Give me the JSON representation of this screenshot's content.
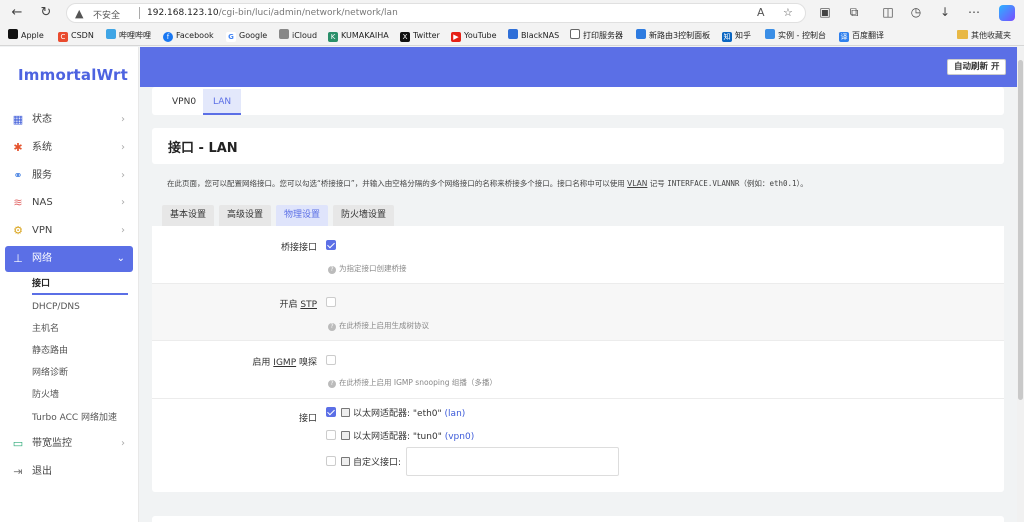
{
  "browser": {
    "security": "不安全",
    "url_host": "192.168.123.10",
    "url_path": "/cgi-bin/luci/admin/network/network/lan",
    "bookmarks": [
      {
        "label": "Apple",
        "icon": "apple-icon",
        "color": "#111111"
      },
      {
        "label": "CSDN",
        "icon": "csdn-icon",
        "color": "#e94b2e"
      },
      {
        "label": "哔哩哔哩",
        "icon": "bilibili-icon",
        "color": "#3fa5e5"
      },
      {
        "label": "Facebook",
        "icon": "facebook-icon",
        "color": "#1877f2"
      },
      {
        "label": "Google",
        "icon": "google-icon",
        "color": "#4285f4"
      },
      {
        "label": "iCloud",
        "icon": "apple-icon",
        "color": "#555555"
      },
      {
        "label": "KUMAKAIHA",
        "icon": "kumakaiha-icon",
        "color": "#2a8f6a"
      },
      {
        "label": "Twitter",
        "icon": "x-icon",
        "color": "#111111"
      },
      {
        "label": "YouTube",
        "icon": "youtube-icon",
        "color": "#e62117"
      },
      {
        "label": "BlackNAS",
        "icon": "blacknas-icon",
        "color": "#2f6fd8"
      },
      {
        "label": "打印服务器",
        "icon": "page-icon",
        "color": "#666666"
      },
      {
        "label": "新路由3控制面板",
        "icon": "wifi-icon",
        "color": "#2d7be0"
      },
      {
        "label": "知乎",
        "icon": "zhihu-icon",
        "color": "#0a66c2"
      },
      {
        "label": "实例 - 控制台",
        "icon": "cloud-icon",
        "color": "#3a8ee6"
      },
      {
        "label": "百度翻译",
        "icon": "baidu-translate-icon",
        "color": "#2f80ed"
      }
    ],
    "other_bookmarks": "其他收藏夹"
  },
  "app": {
    "logo": "ImmortalWrt",
    "refresh_button": "自动刷新 开",
    "accent_color": "#5b6fe6"
  },
  "sidebar": {
    "items": [
      {
        "label": "状态",
        "icon": "status-icon"
      },
      {
        "label": "系统",
        "icon": "system-icon"
      },
      {
        "label": "服务",
        "icon": "services-icon"
      },
      {
        "label": "NAS",
        "icon": "nas-icon"
      },
      {
        "label": "VPN",
        "icon": "vpn-icon"
      },
      {
        "label": "网络",
        "icon": "network-icon"
      },
      {
        "label": "带宽监控",
        "icon": "bandwidth-icon"
      },
      {
        "label": "退出",
        "icon": "logout-icon"
      }
    ],
    "network_sub": [
      "接口",
      "DHCP/DNS",
      "主机名",
      "静态路由",
      "网络诊断",
      "防火墙",
      "Turbo ACC 网络加速"
    ]
  },
  "zone_tabs": [
    "VPN0",
    "LAN"
  ],
  "page": {
    "title": "接口 - LAN",
    "desc_1": "在此页面，您可以配置网络接口。您可以勾选“桥接接口”，并输入由空格分隔的多个网络接口的名称来桥接多个接口。接口名称中可以使用",
    "desc_vlan": "VLAN",
    "desc_2": "记号",
    "desc_mono": "INTERFACE.VLANNR",
    "desc_3": "（例如：",
    "desc_example": "eth0.1",
    "desc_4": "）。"
  },
  "settings_tabs": [
    "基本设置",
    "高级设置",
    "物理设置",
    "防火墙设置"
  ],
  "form": {
    "bridge": {
      "label": "桥接接口",
      "checked": true,
      "hint": "为指定接口创建桥接"
    },
    "stp": {
      "label_pre": "开启 ",
      "label_abbr": "STP",
      "checked": false,
      "hint": "在此桥接上启用生成树协议"
    },
    "igmp": {
      "label_pre": "启用 ",
      "label_abbr": "IGMP",
      "label_post": " 嗅探",
      "checked": false,
      "hint": "在此桥接上启用 IGMP snooping 组播（多播）"
    },
    "iface": {
      "label": "接口",
      "options": [
        {
          "text": "以太网适配器: \"eth0\"",
          "net": "(lan)",
          "checked": true
        },
        {
          "text": "以太网适配器: \"tun0\"",
          "net": "(vpn0)",
          "checked": false
        }
      ],
      "custom_label": "自定义接口:",
      "custom_value": ""
    }
  }
}
